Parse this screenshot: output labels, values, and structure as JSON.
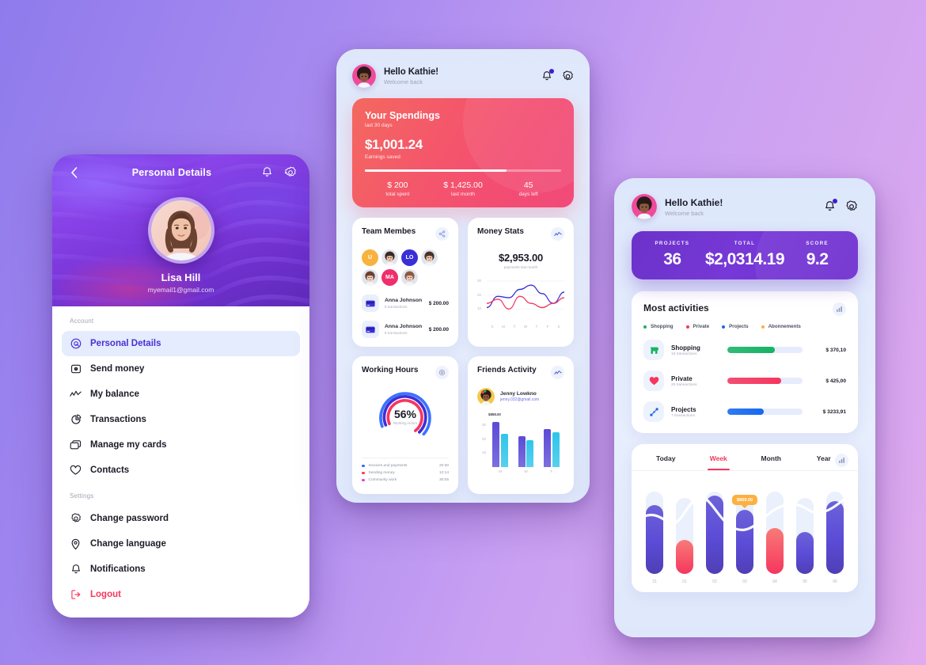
{
  "background": {
    "from": "#8f7bec",
    "to": "#e0abee"
  },
  "phone_personal": {
    "header": {
      "back_icon": "chevron-left-icon",
      "title": "Personal Details",
      "bell_icon": "bell-icon",
      "gear_icon": "gear-icon"
    },
    "profile": {
      "name": "Lisa Hill",
      "email": "myemail1@gmail.com",
      "avatar": "user-photo"
    },
    "sections": [
      {
        "label": "Account",
        "items": [
          {
            "label": "Personal Details",
            "icon": "user-circle-icon",
            "active": true
          },
          {
            "label": "Send money",
            "icon": "send-money-icon",
            "active": false
          },
          {
            "label": "My balance",
            "icon": "chart-line-icon",
            "active": false
          },
          {
            "label": "Transactions",
            "icon": "pie-chart-icon",
            "active": false
          },
          {
            "label": "Manage my cards",
            "icon": "cards-icon",
            "active": false
          },
          {
            "label": "Contacts",
            "icon": "heart-icon",
            "active": false
          }
        ]
      },
      {
        "label": "Settings",
        "items": [
          {
            "label": "Change password",
            "icon": "gear-icon",
            "active": false
          },
          {
            "label": "Change language",
            "icon": "location-pin-icon",
            "active": false
          },
          {
            "label": "Notifications",
            "icon": "bell-icon",
            "active": false
          }
        ]
      }
    ],
    "logout": {
      "label": "Logout",
      "icon": "logout-icon",
      "color": "#f6365e"
    }
  },
  "phone_spendings": {
    "header": {
      "greeting": "Hello Kathie!",
      "subtitle": "Welcome back",
      "bell_icon": "bell-icon",
      "gear_icon": "gear-icon",
      "avatar": "kathie-photo"
    },
    "spend_card": {
      "title": "Your Spendings",
      "subtitle": "last 30 days",
      "amount": "$1,001.24",
      "amount_label": "Earnings saved",
      "progress_pct": 72,
      "stats": [
        {
          "value": "$ 200",
          "label": "total spent"
        },
        {
          "value": "$ 1,425.00",
          "label": "last month"
        },
        {
          "value": "45",
          "label": "days left"
        }
      ],
      "accent_from": "#f4685f",
      "accent_to": "#f24a7a"
    },
    "team_members": {
      "title": "Team Membes",
      "badge_icon": "share-icon",
      "avatars": [
        {
          "type": "initials",
          "text": "U",
          "color": "#f8b23e"
        },
        {
          "type": "photo",
          "text": "",
          "color": ""
        },
        {
          "type": "initials",
          "text": "LO",
          "color": "#3a2fd6"
        },
        {
          "type": "photo",
          "text": "",
          "color": ""
        },
        {
          "type": "photo",
          "text": "",
          "color": ""
        },
        {
          "type": "initials",
          "text": "MA",
          "color": "#ef2f6b"
        },
        {
          "type": "photo",
          "text": "",
          "color": ""
        }
      ],
      "transactions": [
        {
          "icon": "credit-card-icon",
          "name": "Anna Johnson",
          "sub": "8 transactions",
          "amount": "$ 200.00"
        },
        {
          "icon": "credit-card-icon",
          "name": "Anna Johnson",
          "sub": "8 transactions",
          "amount": "$ 200.00"
        }
      ]
    },
    "money_stats": {
      "title": "Money Stats",
      "badge_icon": "chart-line-icon",
      "amount": "$2,953.00",
      "subtitle": "payments last month"
    },
    "working_hours": {
      "title": "Working Hours",
      "badge_icon": "gear-icon",
      "percent": "56%",
      "percent_label": "Working Hours",
      "legend": [
        {
          "name": "Invoices and payments",
          "value": "20:30",
          "color": "#2f6bff"
        },
        {
          "name": "Sending money",
          "value": "12:14",
          "color": "#f6365e"
        },
        {
          "name": "Community work",
          "value": "30:05",
          "color": "#e640c6"
        }
      ]
    },
    "friends_activity": {
      "title": "Friends Activity",
      "badge_icon": "chart-line-icon",
      "person": {
        "name": "Jenny Lowkno",
        "email": "jenny.032@gmail.com",
        "avatar": "jenny-photo"
      },
      "data_label": "$858.00"
    }
  },
  "phone_projects": {
    "header": {
      "greeting": "Hello Kathie!",
      "subtitle": "Welcome back",
      "bell_icon": "bell-icon",
      "gear_icon": "gear-icon",
      "avatar": "kathie-photo"
    },
    "summary": [
      {
        "label": "PROJECTS",
        "value": "36"
      },
      {
        "label": "TOTAL",
        "value": "$2,0314.19"
      },
      {
        "label": "SCORE",
        "value": "9.2"
      }
    ],
    "activities": {
      "title": "Most activities",
      "badge_icon": "bar-chart-icon",
      "legend": [
        {
          "label": "Shopping",
          "color": "#16b364"
        },
        {
          "label": "Private",
          "color": "#f6365e"
        },
        {
          "label": "Projects",
          "color": "#1668ef"
        },
        {
          "label": "Abonnements",
          "color": "#fbb040"
        }
      ],
      "rows": [
        {
          "icon": "store-icon",
          "name": "Shopping",
          "sub": "16 transactions",
          "amount": "$ 370,10",
          "pct": 63,
          "color": "#16b364"
        },
        {
          "icon": "heart-icon",
          "name": "Private",
          "sub": "20 transactions",
          "amount": "$ 425,00",
          "pct": 72,
          "color": "#f6365e"
        },
        {
          "icon": "projects-icon",
          "name": "Projects",
          "sub": "7 transactions",
          "amount": "$ 3233,91",
          "pct": 48,
          "color": "#1668ef"
        }
      ]
    },
    "chart": {
      "badge_icon": "bar-chart-icon",
      "tabs": [
        {
          "label": "Today",
          "active": false
        },
        {
          "label": "Week",
          "active": true
        },
        {
          "label": "Month",
          "active": false
        },
        {
          "label": "Year",
          "active": false
        }
      ],
      "tooltip": "$869.00"
    }
  },
  "chart_data": [
    {
      "id": "money-stats-line",
      "type": "line",
      "title": "Money Stats",
      "xlabel": "",
      "ylabel": "",
      "categories": [
        "S",
        "M",
        "T",
        "W",
        "T",
        "F",
        "S"
      ],
      "yticks": [
        10,
        20,
        30
      ],
      "ylim": [
        0,
        35
      ],
      "grid": true,
      "series": [
        {
          "name": "series-blue",
          "color": "#3a2fd6",
          "values": [
            11,
            19,
            18,
            24,
            27,
            21,
            14,
            22
          ]
        },
        {
          "name": "series-red",
          "color": "#f6365e",
          "values": [
            14,
            17,
            10,
            19,
            14,
            11,
            14,
            18
          ]
        }
      ]
    },
    {
      "id": "working-hours-donut",
      "type": "pie",
      "title": "Working Hours",
      "center_value": "56%",
      "center_label": "Working Hours",
      "slices": [
        {
          "name": "Invoices and payments",
          "value": 20.5,
          "display": "20:30",
          "color": "#2f6bff"
        },
        {
          "name": "Sending money",
          "value": 12.23,
          "display": "12:14",
          "color": "#f6365e"
        },
        {
          "name": "Community work",
          "value": 30.08,
          "display": "30:05",
          "color": "#e640c6"
        }
      ]
    },
    {
      "id": "friends-activity-bars",
      "type": "bar",
      "title": "Friends Activity",
      "categories": [
        "M",
        "W",
        "F"
      ],
      "yticks": [
        10,
        20,
        30
      ],
      "ylim": [
        0,
        35
      ],
      "annotation": "$858.00",
      "series": [
        {
          "name": "primary",
          "color": "#5b4bd6",
          "values": [
            32,
            22,
            27
          ]
        },
        {
          "name": "secondary",
          "color": "#2ec5ea",
          "values": [
            24,
            19,
            25
          ]
        }
      ]
    },
    {
      "id": "week-bars",
      "type": "bar",
      "title": "Week",
      "categories": [
        "31",
        "01",
        "02",
        "03",
        "04",
        "05",
        "06"
      ],
      "values": [
        78,
        38,
        88,
        72,
        52,
        47,
        82
      ],
      "colors": [
        "#6a5ad4",
        "#f6576a",
        "#6a5ad4",
        "#6a5ad4",
        "#f6576a",
        "#6a5ad4",
        "#6a5ad4"
      ],
      "tooltip_index": 3,
      "tooltip": "$869.00",
      "overlay_line": true
    }
  ]
}
